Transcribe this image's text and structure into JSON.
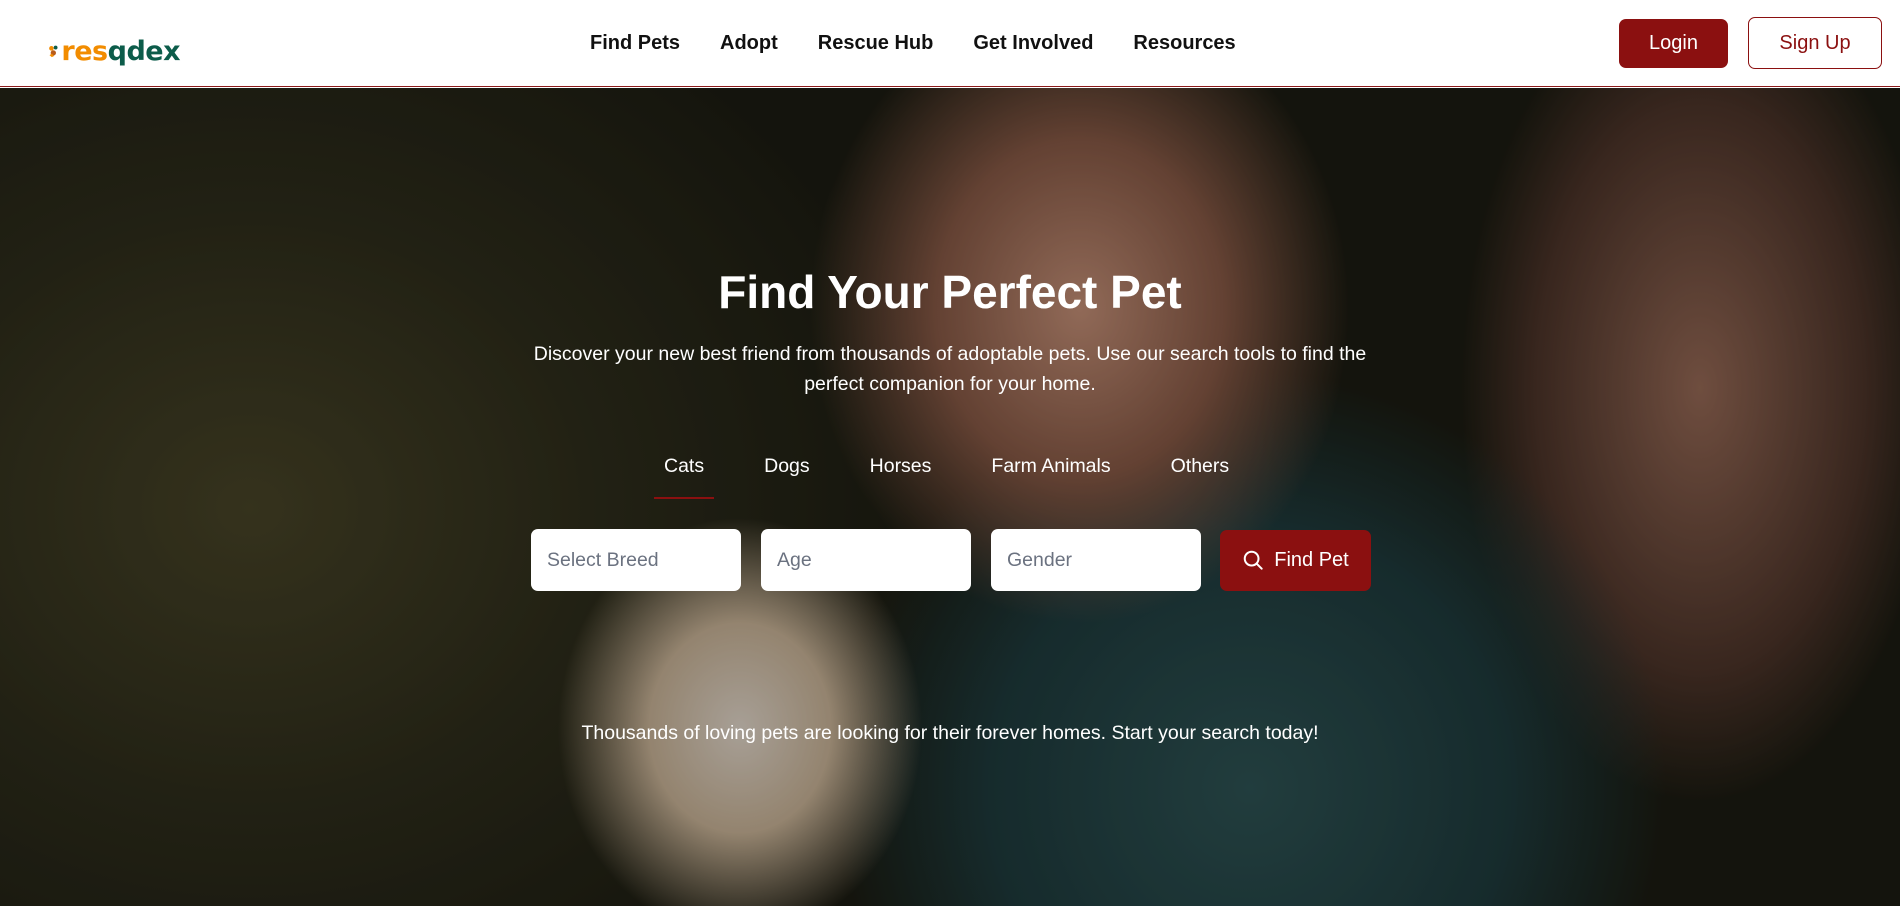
{
  "header": {
    "logo": {
      "text_main": "res",
      "text_accent": "q",
      "text_end": "dex",
      "colors": {
        "main": "#f28c00",
        "accent": "#0c5c4a",
        "end": "#0c5c4a"
      }
    },
    "nav": [
      {
        "label": "Find Pets"
      },
      {
        "label": "Adopt"
      },
      {
        "label": "Rescue Hub"
      },
      {
        "label": "Get Involved"
      },
      {
        "label": "Resources"
      }
    ],
    "login_label": "Login",
    "signup_label": "Sign Up"
  },
  "hero": {
    "title": "Find Your Perfect Pet",
    "subtitle": "Discover your new best friend from thousands of adoptable pets. Use our search tools to find the perfect companion for your home.",
    "tabs": [
      {
        "label": "Cats",
        "active": true
      },
      {
        "label": "Dogs",
        "active": false
      },
      {
        "label": "Horses",
        "active": false
      },
      {
        "label": "Farm Animals",
        "active": false
      },
      {
        "label": "Others",
        "active": false
      }
    ],
    "search": {
      "breed_placeholder": "Select Breed",
      "age_placeholder": "Age",
      "gender_placeholder": "Gender",
      "button_label": "Find Pet",
      "button_icon": "search-icon"
    },
    "note": "Thousands of loving pets are looking for their forever homes. Start your search today!"
  },
  "colors": {
    "accent": "#8b1010",
    "text_light": "#ffffff",
    "text_dark": "#111111"
  }
}
